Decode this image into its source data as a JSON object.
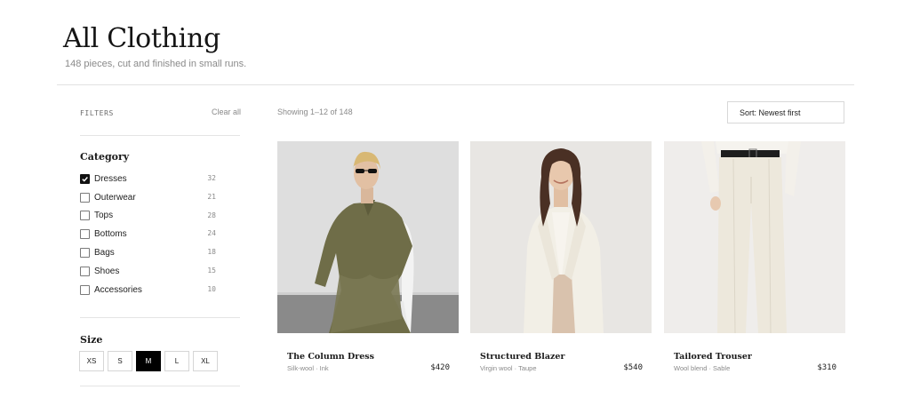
{
  "header": {
    "title": "All Clothing",
    "subtitle": "148 pieces, cut and finished in small runs."
  },
  "filters": {
    "label": "FILTERS",
    "clear_label": "Clear all",
    "category": {
      "title": "Category",
      "items": [
        {
          "label": "Dresses",
          "count": "32",
          "checked": true
        },
        {
          "label": "Outerwear",
          "count": "21",
          "checked": false
        },
        {
          "label": "Tops",
          "count": "28",
          "checked": false
        },
        {
          "label": "Bottoms",
          "count": "24",
          "checked": false
        },
        {
          "label": "Bags",
          "count": "18",
          "checked": false
        },
        {
          "label": "Shoes",
          "count": "15",
          "checked": false
        },
        {
          "label": "Accessories",
          "count": "10",
          "checked": false
        }
      ]
    },
    "size": {
      "title": "Size",
      "options": [
        "XS",
        "S",
        "M",
        "L",
        "XL"
      ],
      "selected": "M"
    }
  },
  "results": {
    "showing": "Showing 1–12 of 148",
    "sort_value": "Sort: Newest first"
  },
  "products": [
    {
      "name": "The Column Dress",
      "meta": "Silk-wool · Ink",
      "price": "$420",
      "image": "model-olive-outfit-seated",
      "bg": "#dcdcdc"
    },
    {
      "name": "Structured Blazer",
      "meta": "Virgin wool · Taupe",
      "price": "$540",
      "image": "model-cream-blazer",
      "bg": "#e6e4e1"
    },
    {
      "name": "Tailored Trouser",
      "meta": "Wool blend · Sable",
      "price": "$310",
      "image": "cream-trousers-belt",
      "bg": "#eeecea"
    }
  ],
  "colors": {
    "accent": "#000000",
    "text": "#1a1a1a",
    "muted": "#8a8a8a",
    "border": "#e2e2e2"
  }
}
